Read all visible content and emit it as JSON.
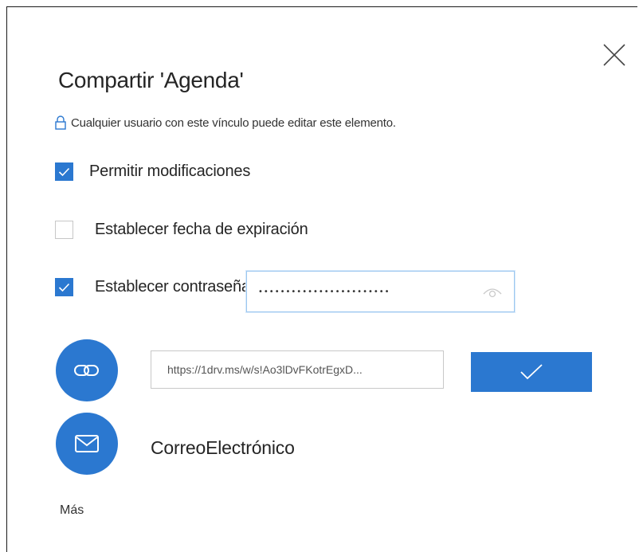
{
  "dialog": {
    "title": "Compartir 'Agenda'",
    "close_icon": "close-icon"
  },
  "notice": {
    "icon": "lock-icon",
    "text": "Cualquier usuario con este vínculo puede editar este elemento."
  },
  "options": [
    {
      "label": "Permitir modificaciones",
      "checked": true
    },
    {
      "label": "Establecer fecha de expiración",
      "checked": false
    },
    {
      "label": "Establecer contraseña...",
      "checked": true
    }
  ],
  "password": {
    "value": "••••••••••••••••••••••••",
    "icon": "eye-icon"
  },
  "link": {
    "icon": "link-icon",
    "value": "https://1drv.ms/w/s!Ao3lDvFKotrEgxD..."
  },
  "confirm": {
    "icon": "checkmark-icon"
  },
  "email": {
    "icon": "envelope-icon",
    "label": "CorreoElectrónico"
  },
  "more": {
    "label": "Más"
  },
  "colors": {
    "accent": "#2b78d0",
    "text": "#252525",
    "border": "#c8c8c8"
  }
}
